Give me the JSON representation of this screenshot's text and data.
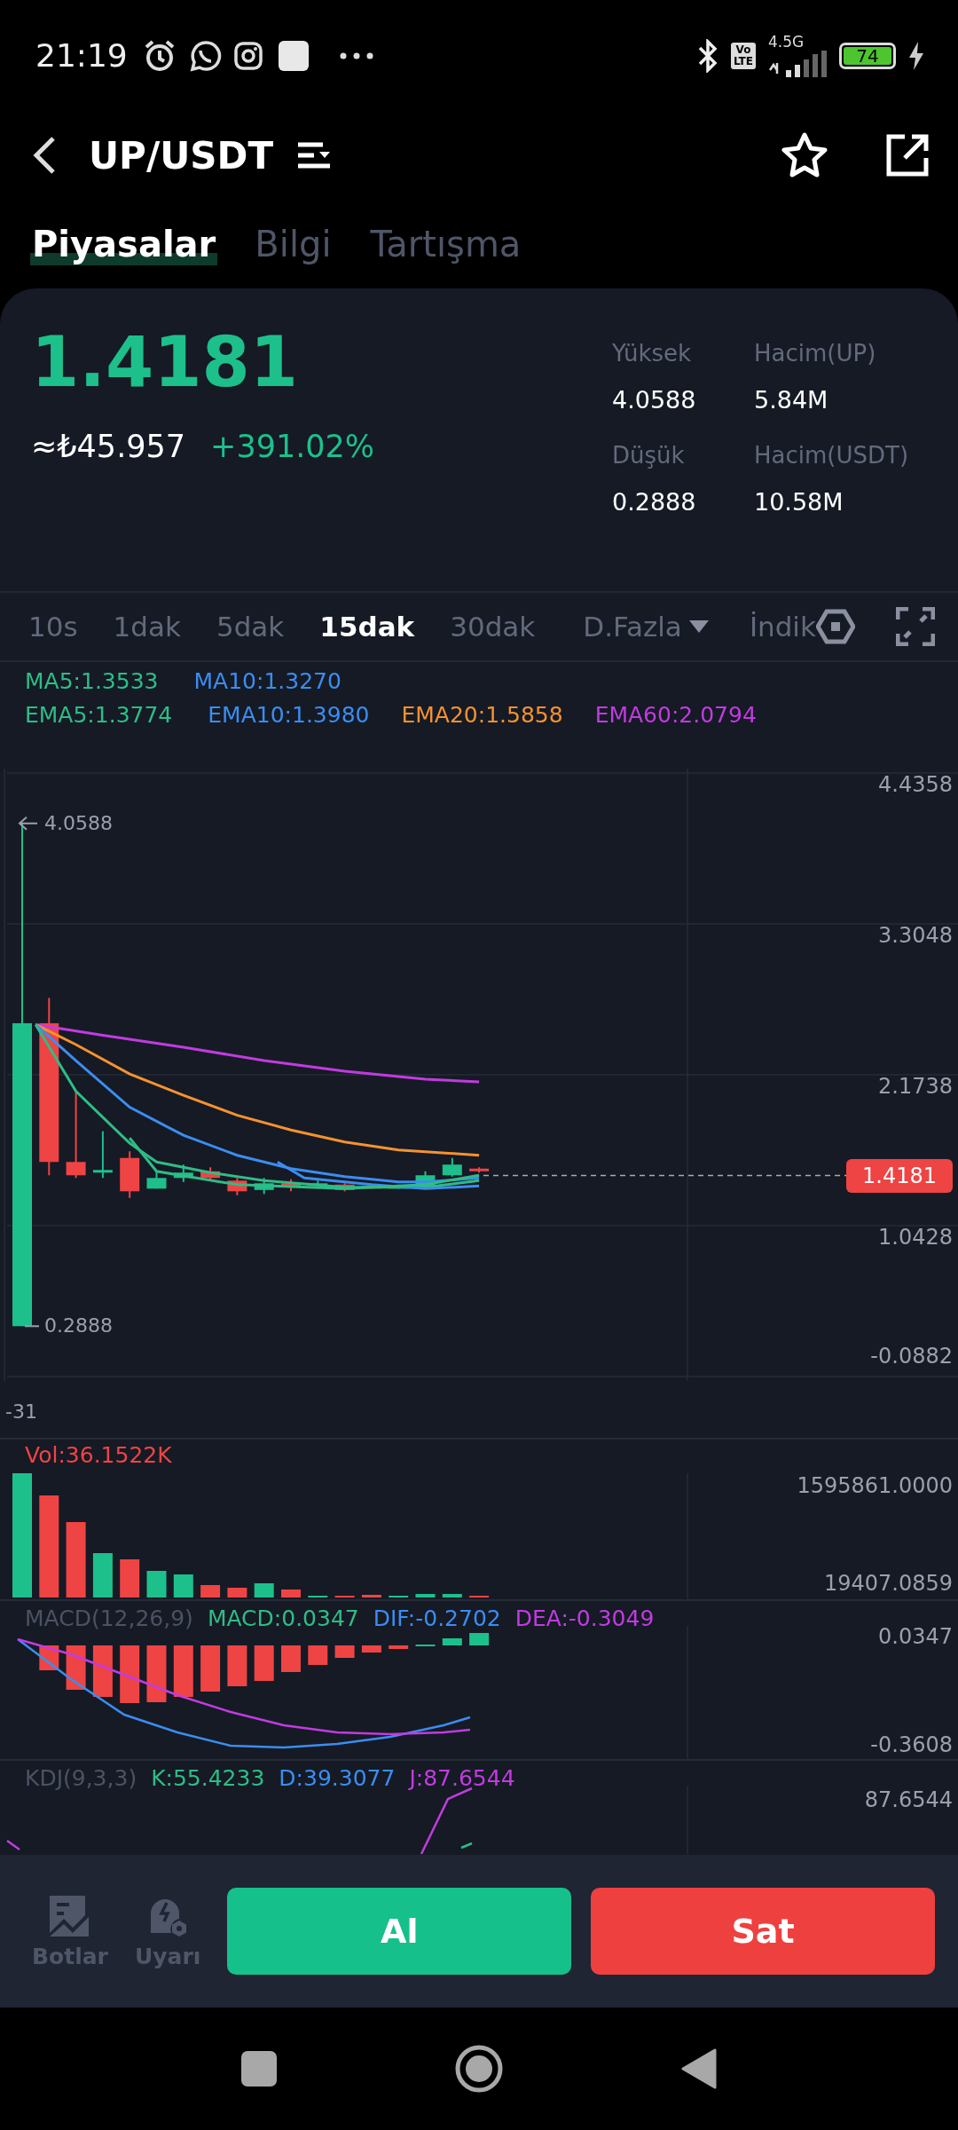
{
  "status_bar": {
    "time": "21:19",
    "volte": [
      "Vo",
      "LTE"
    ],
    "network": "4.5G",
    "battery": "74"
  },
  "header": {
    "title": "UP/USDT"
  },
  "tabs": [
    {
      "label": "Piyasalar",
      "selected": true
    },
    {
      "label": "Bilgi",
      "selected": false
    },
    {
      "label": "Tartışma",
      "selected": false
    }
  ],
  "ticker": {
    "price": "1.4181",
    "fiat": "≈₺45.957",
    "change": "+391.02%",
    "stats": [
      {
        "label": "Yüksek",
        "value": "4.0588"
      },
      {
        "label": "Hacim(UP)",
        "value": "5.84M"
      },
      {
        "label": "Düşük",
        "value": "0.2888"
      },
      {
        "label": "Hacim(USDT)",
        "value": "10.58M"
      }
    ]
  },
  "timeframes": [
    {
      "label": "10s",
      "selected": false
    },
    {
      "label": "1dak",
      "selected": false
    },
    {
      "label": "5dak",
      "selected": false
    },
    {
      "label": "15dak",
      "selected": true
    },
    {
      "label": "30dak",
      "selected": false
    }
  ],
  "more": "D.Fazla",
  "indicators": "İndik",
  "ma_legend": [
    [
      {
        "text": "MA5:1.3533",
        "color": "#2ebd85"
      },
      {
        "text": "MA10:1.3270",
        "color": "#3b8df0"
      }
    ],
    [
      {
        "text": "EMA5:1.3774",
        "color": "#2ebd85"
      },
      {
        "text": "EMA10:1.3980",
        "color": "#3b8df0"
      },
      {
        "text": "EMA20:1.5858",
        "color": "#f5922f"
      },
      {
        "text": "EMA60:2.0794",
        "color": "#c23be0"
      }
    ]
  ],
  "main_chart": {
    "y_labels": [
      "4.4358",
      "3.3048",
      "2.1738",
      "1.0428",
      "-0.0882"
    ],
    "high": "4.0588",
    "low": "0.2888",
    "last_price": "1.4181",
    "below": "-31"
  },
  "volume": {
    "legend": "Vol:36.1522K",
    "y_labels": [
      "1595861.0000",
      "19407.0859"
    ]
  },
  "macd": {
    "legend": [
      {
        "text": "MACD(12,26,9)",
        "color": "#4b5263"
      },
      {
        "text": "MACD:0.0347",
        "color": "#2ebd85"
      },
      {
        "text": "DIF:-0.2702",
        "color": "#3b8df0"
      },
      {
        "text": "DEA:-0.3049",
        "color": "#c23be0"
      }
    ],
    "y_labels": [
      "0.0347",
      "-0.3608"
    ]
  },
  "kdj": {
    "legend": [
      {
        "text": "KDJ(9,3,3)",
        "color": "#4b5263"
      },
      {
        "text": "K:55.4233",
        "color": "#2ebd85"
      },
      {
        "text": "D:39.3077",
        "color": "#3b8df0"
      },
      {
        "text": "J:87.6544",
        "color": "#c23be0"
      }
    ],
    "y_labels": [
      "87.6544"
    ]
  },
  "bottom_bar": {
    "actions": [
      {
        "kind": "bots",
        "label": "Botlar"
      },
      {
        "kind": "alert",
        "label": "Uyarı"
      }
    ],
    "buy": "Al",
    "sell": "Sat"
  }
}
